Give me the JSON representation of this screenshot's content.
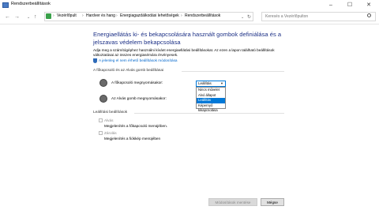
{
  "window": {
    "title": "Rendszerbeállítások",
    "min": "–",
    "max": "☐",
    "close": "✕"
  },
  "address": {
    "back": "←",
    "forward": "→",
    "up": "↑",
    "crumbs": [
      "Vezérlőpult",
      "Hardver és hang",
      "Energiagazdálkodási lehetőségek",
      "Rendszerbeállítások"
    ],
    "separator": "›",
    "dropdown": "⌄",
    "refresh": "↻",
    "search_placeholder": "Keresés a Vezérlőpulton"
  },
  "content": {
    "heading": "Energiaellátás ki- és bekapcsolására használt gombok definiálása és a jelszavas védelem bekapcsolása",
    "description": "Adja meg a számítógéphez használni kívánt energiaellátási beállításokat. Az ezen a lapon található beállítások változtatásai az összes energiasémára érvényesek.",
    "link": "A jelenleg el nem érhető beállítások módosítása",
    "section_buttons": "A főkapcsoló és az Alvás gomb beállításai",
    "power_label": "A főkapcsoló megnyomásakor:",
    "sleep_label": "Az Alvás gomb megnyomásakor:",
    "select_value": "Leállítás",
    "options": [
      "Nincs művelet",
      "Alvó állapot",
      "Leállítás",
      "Képernyő kikapcsolása"
    ],
    "selected_option": 2,
    "section_shutdown": "Leállítási beállítások",
    "sleep_check": "Alvás",
    "sleep_sub": "Megjelenítés a főkapcsoló menüjében.",
    "lock_check": "Zárolás",
    "lock_sub": "Megjelenítés a fiókkép menüjében"
  },
  "footer": {
    "save": "Módosítások mentése",
    "cancel": "Mégse"
  }
}
